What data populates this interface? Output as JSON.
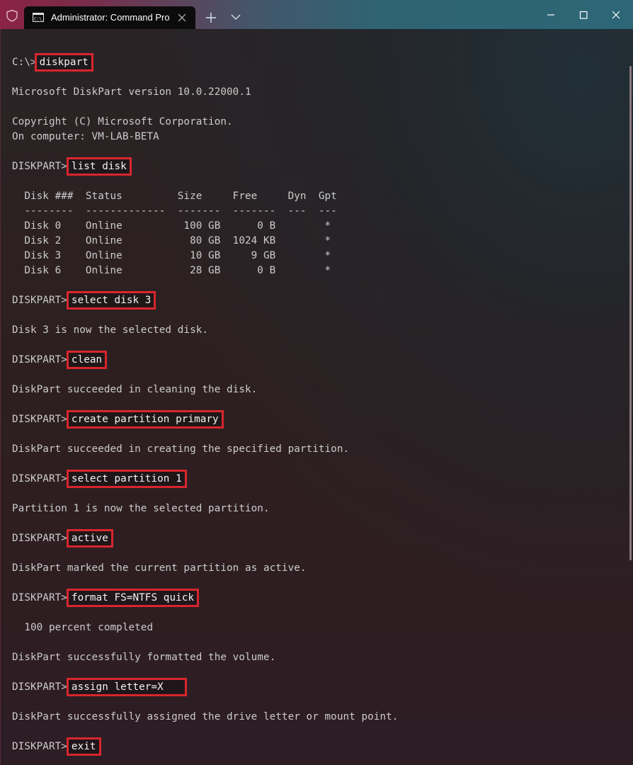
{
  "window": {
    "tab_title": "Administrator: Command Prompt",
    "icons": {
      "shield": "shield-icon",
      "tab": "command-prompt-icon",
      "tab_close": "close-icon",
      "new_tab": "plus-icon",
      "dropdown": "chevron-down-icon",
      "minimize": "minimize-icon",
      "maximize": "maximize-icon",
      "close": "close-icon"
    },
    "highlight_color": "#d8262e"
  },
  "terminal": {
    "initial_prompt": "C:\\>",
    "initial_command": "diskpart",
    "version_line": "Microsoft DiskPart version 10.0.22000.1",
    "copyright_line": "Copyright (C) Microsoft Corporation.",
    "computer_line": "On computer: VM-LAB-BETA",
    "prompt": "DISKPART>",
    "commands": [
      "list disk",
      "select disk 3",
      "clean",
      "create partition primary",
      "select partition 1",
      "active",
      "format FS=NTFS quick",
      "assign letter=X",
      "exit"
    ],
    "disk_table": {
      "headers": [
        "Disk ###",
        "Status",
        "Size",
        "Free",
        "Dyn",
        "Gpt"
      ],
      "separator": "  --------  -------------  -------  -------  ---  ---",
      "header_line": "  Disk ###  Status         Size     Free     Dyn  Gpt",
      "rows": [
        {
          "disk": "Disk 0",
          "status": "Online",
          "size": "100 GB",
          "free": "0 B",
          "dyn": "",
          "gpt": "*",
          "line": "  Disk 0    Online          100 GB      0 B        *"
        },
        {
          "disk": "Disk 2",
          "status": "Online",
          "size": "80 GB",
          "free": "1024 KB",
          "dyn": "",
          "gpt": "*",
          "line": "  Disk 2    Online           80 GB  1024 KB        *"
        },
        {
          "disk": "Disk 3",
          "status": "Online",
          "size": "10 GB",
          "free": "9 GB",
          "dyn": "",
          "gpt": "*",
          "line": "  Disk 3    Online           10 GB     9 GB        *"
        },
        {
          "disk": "Disk 6",
          "status": "Online",
          "size": "28 GB",
          "free": "0 B",
          "dyn": "",
          "gpt": "*",
          "line": "  Disk 6    Online           28 GB      0 B        *"
        }
      ]
    },
    "outputs": {
      "select_disk": "Disk 3 is now the selected disk.",
      "clean": "DiskPart succeeded in cleaning the disk.",
      "create_partition": "DiskPart succeeded in creating the specified partition.",
      "select_partition": "Partition 1 is now the selected partition.",
      "active": "DiskPart marked the current partition as active.",
      "format_progress": "  100 percent completed",
      "format_done": "DiskPart successfully formatted the volume.",
      "assign": "DiskPart successfully assigned the drive letter or mount point."
    }
  }
}
